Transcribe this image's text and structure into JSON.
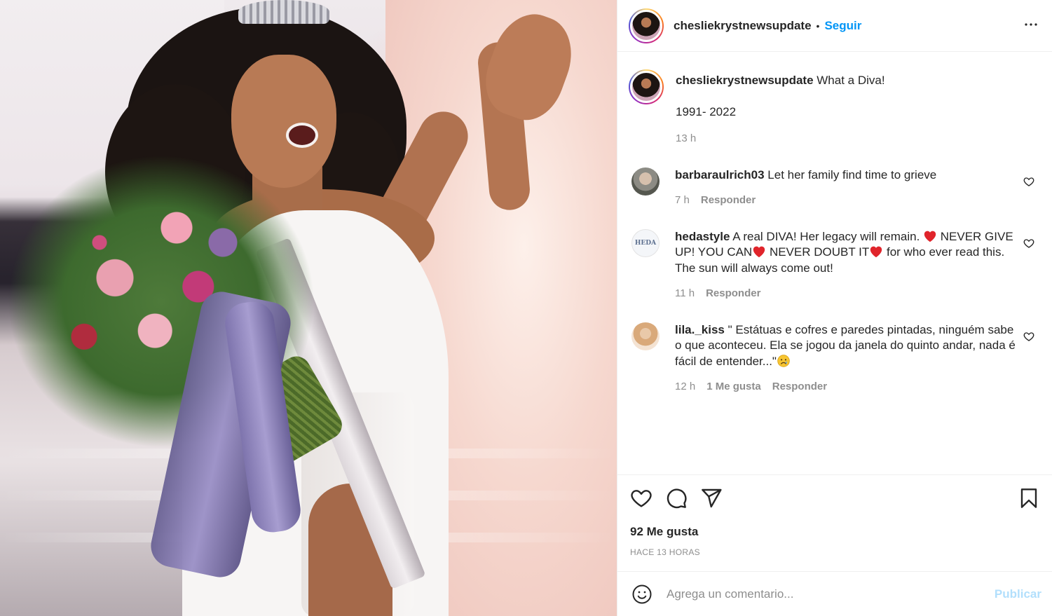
{
  "post": {
    "username": "chesliekrystnewsupdate",
    "follow_label": "Seguir",
    "dot": "•",
    "more": "•••"
  },
  "caption": {
    "username": "chesliekrystnewsupdate",
    "text": "What a Diva!",
    "line2": "1991- 2022",
    "time": "13 h"
  },
  "comments": [
    {
      "username": "barbaraulrich03",
      "text": "Let her family find time to grieve",
      "time": "7 h",
      "reply_label": "Responder"
    },
    {
      "username": "hedastyle",
      "text_parts": [
        "A real DIVA! Her legacy will remain. ",
        " NEVER GIVE UP! YOU CAN",
        " NEVER DOUBT IT",
        " for who ever read this. The sun will always come out!"
      ],
      "avatar_text": "HEDA",
      "time": "11 h",
      "reply_label": "Responder"
    },
    {
      "username": "lila._kiss",
      "text": "\" Estátuas e cofres e paredes pintadas, ninguém sabe o que aconteceu. Ela se jogou da janela do quinto andar, nada é fácil de entender...\"",
      "time": "12 h",
      "likes_label": "1 Me gusta",
      "reply_label": "Responder"
    }
  ],
  "actions": {
    "likes": "92 Me gusta",
    "time_ago": "HACE 13 HORAS"
  },
  "comment_box": {
    "placeholder": "Agrega un comentario...",
    "publish_label": "Publicar"
  },
  "colors": {
    "accent": "#0095f6",
    "publish_disabled": "#b2dffc",
    "heart_emoji": "#e0242b",
    "muted_text": "#8e8e8e"
  },
  "icons": [
    "more-options-icon",
    "heart-icon",
    "comment-icon",
    "share-icon",
    "bookmark-icon",
    "emoji-icon",
    "heart-emoji-icon",
    "sad-emoji-icon"
  ]
}
